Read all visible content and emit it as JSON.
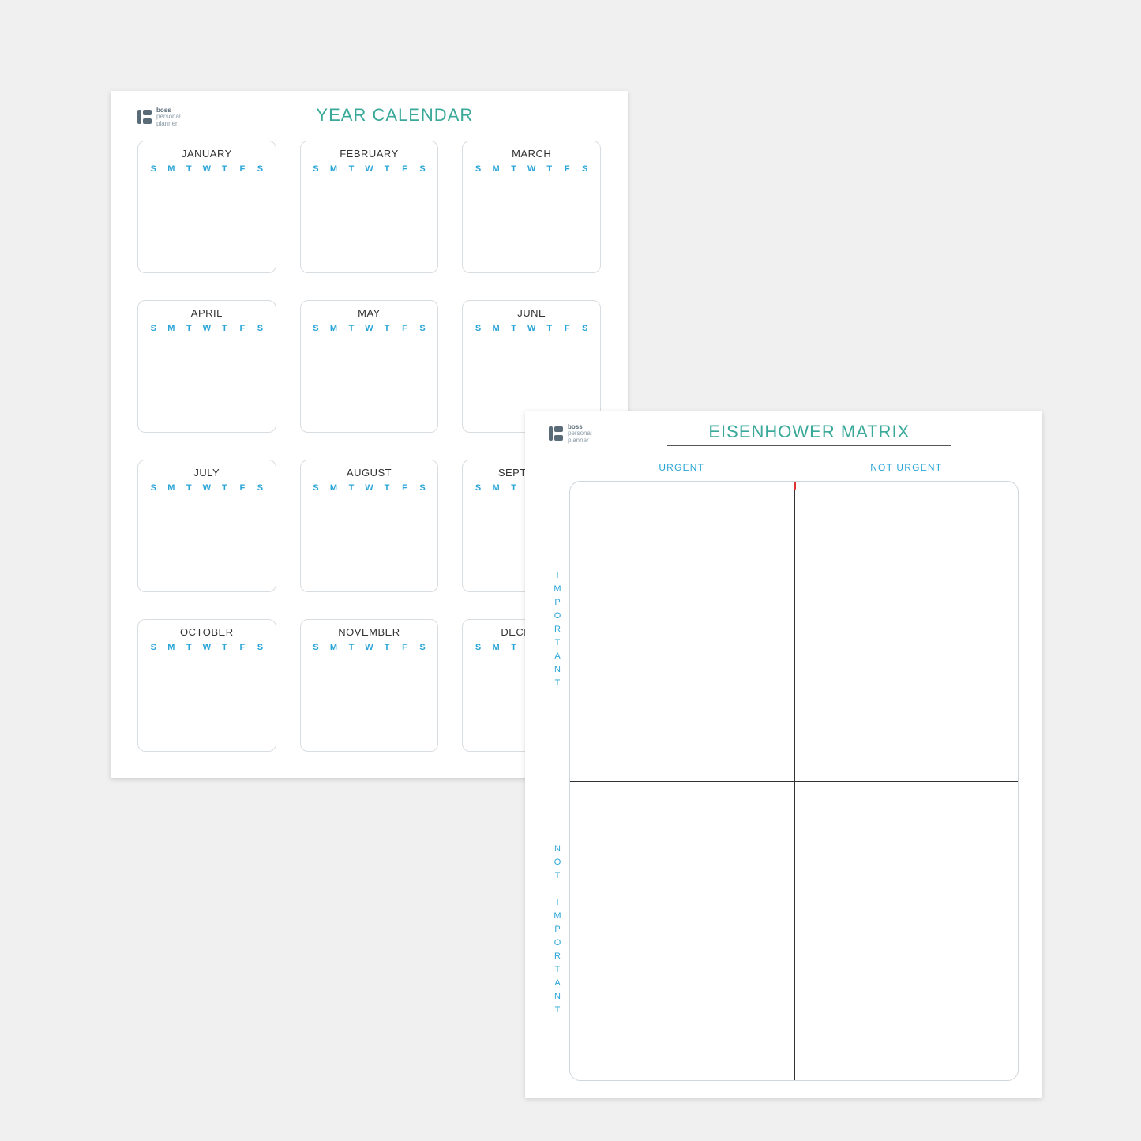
{
  "brand": {
    "line1": "boss",
    "line2": "personal",
    "line3": "planner"
  },
  "colors": {
    "accent_teal": "#3aa99a",
    "accent_blue": "#2aa5d8"
  },
  "calendar": {
    "title": "YEAR CALENDAR",
    "day_headers": [
      "S",
      "M",
      "T",
      "W",
      "T",
      "F",
      "S"
    ],
    "months": [
      "JANUARY",
      "FEBRUARY",
      "MARCH",
      "APRIL",
      "MAY",
      "JUNE",
      "JULY",
      "AUGUST",
      "SEPTEMBER",
      "OCTOBER",
      "NOVEMBER",
      "DECEMBER"
    ]
  },
  "matrix": {
    "title": "EISENHOWER MATRIX",
    "cols": [
      "URGENT",
      "NOT URGENT"
    ],
    "rows": [
      "IMPORTANT",
      "NOT IMPORTANT"
    ]
  }
}
